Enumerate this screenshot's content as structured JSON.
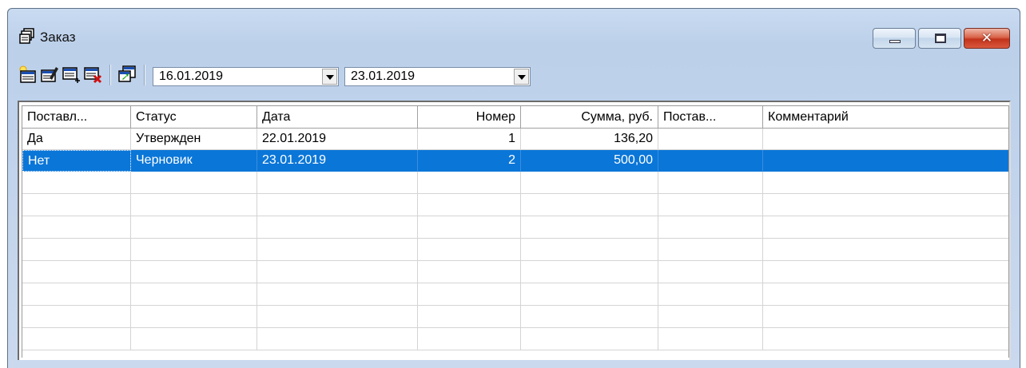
{
  "window": {
    "title": "Заказ"
  },
  "toolbar": {
    "date_from": "16.01.2019",
    "date_to": "23.01.2019"
  },
  "grid": {
    "columns": [
      "Поставл...",
      "Статус",
      "Дата",
      "Номер",
      "Сумма, руб.",
      "Постав...",
      "Комментарий"
    ],
    "rows": [
      {
        "delivered": "Да",
        "status": "Утвержден",
        "date": "22.01.2019",
        "number": "1",
        "sum": "136,20",
        "supplier": "",
        "comment": ""
      },
      {
        "delivered": "Нет",
        "status": "Черновик",
        "date": "23.01.2019",
        "number": "2",
        "sum": "500,00",
        "supplier": "",
        "comment": ""
      }
    ],
    "selected_row": 1
  },
  "colors": {
    "selection": "#0a76d8",
    "titlebar": "#c9dbf1",
    "close": "#c2331b"
  },
  "icons": [
    "window-icon",
    "new-icon",
    "edit-icon",
    "add-row-icon",
    "delete-icon",
    "export-icon"
  ]
}
